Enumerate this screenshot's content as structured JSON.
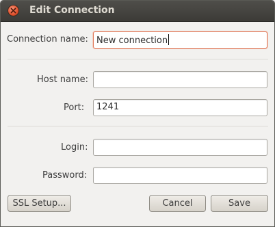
{
  "window": {
    "title": "Edit Connection"
  },
  "form": {
    "connection_name": {
      "label": "Connection name:",
      "value": "New connection"
    },
    "host_name": {
      "label": "Host name:",
      "value": ""
    },
    "port": {
      "label": "Port:",
      "value": "1241"
    },
    "login": {
      "label": "Login:",
      "value": ""
    },
    "password": {
      "label": "Password:",
      "value": ""
    }
  },
  "buttons": {
    "ssl_setup": "SSL Setup...",
    "cancel": "Cancel",
    "save": "Save"
  },
  "colors": {
    "titlebar": "#3c3b37",
    "close_button": "#e0512d",
    "focus_border": "#e07555",
    "background": "#f2f1ef"
  },
  "icons": {
    "close": "close-icon"
  }
}
